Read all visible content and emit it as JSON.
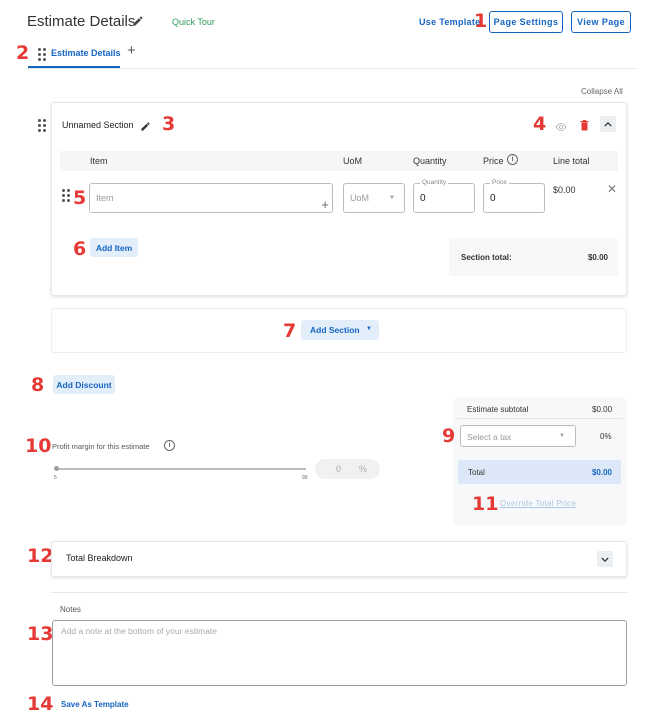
{
  "header": {
    "title": "Estimate Details",
    "quick_tour": "Quick Tour",
    "use_template": "Use Template",
    "page_settings": "Page Settings",
    "view_page": "View Page"
  },
  "tabs": [
    {
      "label": "Estimate Details"
    }
  ],
  "collapse_all": "Collapse All",
  "section": {
    "name": "Unnamed Section",
    "columns": [
      "Item",
      "UoM",
      "Quantity",
      "Price",
      "Line total"
    ],
    "row": {
      "item_placeholder": "Item",
      "uom_placeholder": "UoM",
      "quantity_label": "Quantity",
      "quantity_value": "0",
      "price_label": "Price",
      "price_value": "0",
      "line_total": "$0.00"
    },
    "add_item": "Add Item",
    "section_total_label": "Section total:",
    "section_total_value": "$0.00"
  },
  "add_section": "Add Section",
  "add_discount": "Add Discount",
  "profit": {
    "label": "Profit margin for this estimate",
    "min": "5",
    "max": "99",
    "value": "0",
    "unit": "%",
    "slider_fraction": 0
  },
  "summary": {
    "subtotal_label": "Estimate subtotal",
    "subtotal_value": "$0.00",
    "tax_placeholder": "Select a tax",
    "tax_percent": "0%",
    "total_label": "Total",
    "total_value": "$0.00",
    "override": "Override Total Price"
  },
  "total_breakdown": "Total Breakdown",
  "notes": {
    "label": "Notes",
    "placeholder": "Add a note at the bottom of your estimate"
  },
  "save_as_template": "Save As Template",
  "callouts": [
    "1",
    "2",
    "3",
    "4",
    "5",
    "6",
    "7",
    "8",
    "9",
    "10",
    "11",
    "12",
    "13",
    "14"
  ],
  "colors": {
    "accent": "#1565c0",
    "callout": "#e53935",
    "quick_tour": "#2e9d5b",
    "delete": "#e53935",
    "total_bg": "#dce8f7"
  }
}
